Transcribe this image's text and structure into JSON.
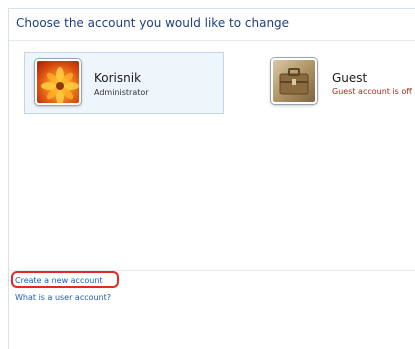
{
  "page": {
    "heading": "Choose the account you would like to change"
  },
  "accounts": [
    {
      "name": "Korisnik",
      "status": "Administrator",
      "selected": true,
      "icon": "flower-avatar-icon"
    },
    {
      "name": "Guest",
      "status": "Guest account is off",
      "selected": false,
      "icon": "briefcase-avatar-icon"
    }
  ],
  "links": {
    "create_account": "Create a new account",
    "what_is": "What is a user account?"
  },
  "colors": {
    "heading": "#1e3f80",
    "link": "#1a5fb4",
    "status_off": "#b3261e",
    "highlight": "#e02a24",
    "tile_selected_bg": "#eef5fb"
  }
}
